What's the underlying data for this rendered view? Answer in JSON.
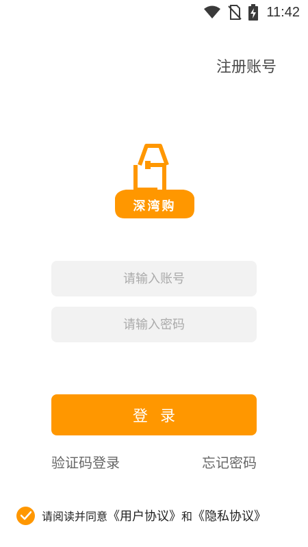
{
  "status_bar": {
    "time": "11:42",
    "icons": [
      "wifi-icon",
      "no-sim-icon",
      "battery-charging-icon"
    ]
  },
  "header": {
    "register_label": "注册账号"
  },
  "logo": {
    "text": "深湾购",
    "color": "#ff9700"
  },
  "form": {
    "account_placeholder": "请输入账号",
    "password_placeholder": "请输入密码",
    "login_label": "登录"
  },
  "links": {
    "sms_login": "验证码登录",
    "forgot_password": "忘记密码"
  },
  "agreement": {
    "checked": true,
    "prefix": "请阅读并同意",
    "user_agreement": "《用户协议》",
    "and": "和",
    "privacy_policy": "《隐私协议》"
  },
  "colors": {
    "accent": "#ff9700",
    "input_bg": "#f2f2f2"
  }
}
